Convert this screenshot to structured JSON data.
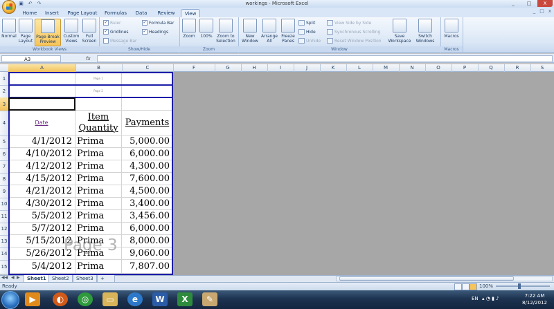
{
  "window": {
    "title": "workings - Microsoft Excel",
    "controls": [
      "_",
      "□",
      "X"
    ],
    "doc_controls": [
      "_",
      "□",
      "x"
    ],
    "qat": [
      "save",
      "undo",
      "redo"
    ]
  },
  "ribbon_tabs": [
    "Home",
    "Insert",
    "Page Layout",
    "Formulas",
    "Data",
    "Review",
    "View"
  ],
  "active_tab": "View",
  "ribbon": {
    "workbook_views": {
      "name": "Workbook Views",
      "normal": "Normal",
      "page_layout": "Page Layout",
      "page_break_preview": "Page Break Preview",
      "custom_views": "Custom Views",
      "full_screen": "Full Screen"
    },
    "show_hide": {
      "name": "Show/Hide",
      "ruler": "Ruler",
      "gridlines": "Gridlines",
      "message_bar": "Message Bar",
      "formula_bar": "Formula Bar",
      "headings": "Headings"
    },
    "zoom": {
      "name": "Zoom",
      "zoom": "Zoom",
      "hundred": "100%",
      "zoom_to_selection": "Zoom to Selection"
    },
    "window": {
      "name": "Window",
      "new_window": "New Window",
      "arrange_all": "Arrange All",
      "freeze_panes": "Freeze Panes",
      "split": "Split",
      "hide": "Hide",
      "unhide": "Unhide",
      "view_side_by_side": "View Side by Side",
      "synchronous_scrolling": "Synchronous Scrolling",
      "reset_window_position": "Reset Window Position",
      "save_workspace": "Save Workspace",
      "switch_windows": "Switch Windows"
    },
    "macros": {
      "name": "Macros",
      "macros": "Macros"
    }
  },
  "formula_bar": {
    "name_box": "A3",
    "fx": "fx",
    "value": ""
  },
  "columns": [
    "A",
    "B",
    "C",
    "F",
    "G",
    "H",
    "I",
    "J",
    "K",
    "L",
    "M",
    "N",
    "O",
    "P",
    "Q",
    "R",
    "S"
  ],
  "rows": [
    "1",
    "2",
    "3",
    "4",
    "5",
    "6",
    "7",
    "8",
    "9",
    "10",
    "11",
    "12",
    "13",
    "14",
    "15"
  ],
  "sheet": {
    "page1_label": "Page 1",
    "page2_label": "Page 2",
    "headers": {
      "date": "Date",
      "item": "Item",
      "quantity": "Quantity",
      "payments": "Payments"
    },
    "records": [
      {
        "date": "4/1/2012",
        "item": "Prima",
        "payment": "5,000.00"
      },
      {
        "date": "4/10/2012",
        "item": "Prima",
        "payment": "6,000.00"
      },
      {
        "date": "4/12/2012",
        "item": "Prima",
        "payment": "4,300.00"
      },
      {
        "date": "4/15/2012",
        "item": "Prima",
        "payment": "7,600.00"
      },
      {
        "date": "4/21/2012",
        "item": "Prima",
        "payment": "4,500.00"
      },
      {
        "date": "4/30/2012",
        "item": "Prima",
        "payment": "3,400.00"
      },
      {
        "date": "5/5/2012",
        "item": "Prima",
        "payment": "3,456.00"
      },
      {
        "date": "5/7/2012",
        "item": "Prima",
        "payment": "6,000.00"
      },
      {
        "date": "5/15/2012",
        "item": "Prima",
        "payment": "8,000.00"
      },
      {
        "date": "5/26/2012",
        "item": "Prima",
        "payment": "9,060.00"
      },
      {
        "date": "5/4/2012",
        "item": "Prima",
        "payment": "7,807.00"
      }
    ],
    "watermark": "Page 3"
  },
  "sheet_tabs": [
    "Sheet1",
    "Sheet2",
    "Sheet3"
  ],
  "active_sheet": "Sheet1",
  "status": {
    "text": "Ready",
    "zoom": "100%"
  },
  "taskbar": {
    "apps": [
      "media-player",
      "firefox",
      "chrome",
      "explorer",
      "ie",
      "word",
      "excel",
      "paint"
    ],
    "lang": "EN",
    "time": "7:22 AM",
    "date": "8/12/2012"
  },
  "colors": {
    "page_break": "#1d1da8",
    "selection": "#f2c25b",
    "ribbon": "#dbe7f6"
  }
}
